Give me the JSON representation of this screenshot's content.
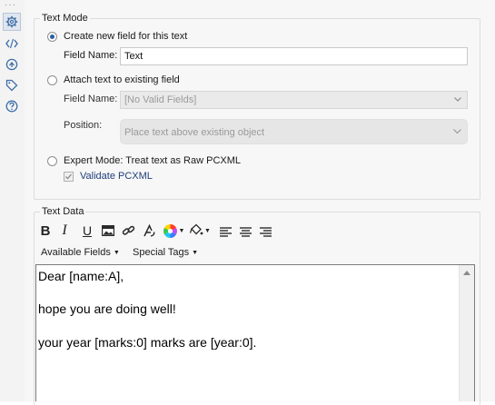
{
  "text_mode": {
    "title": "Text Mode",
    "create_new": {
      "label": "Create new field for this text",
      "selected": true
    },
    "field_name_label": "Field Name:",
    "field_name_value": "Text",
    "attach_existing": {
      "label": "Attach text to existing field",
      "selected": false
    },
    "attach_field_name_label": "Field Name:",
    "attach_field_value": "[No Valid Fields]",
    "position_label": "Position:",
    "position_value": "Place text above existing object",
    "expert_mode": {
      "label": "Expert Mode: Treat text as Raw PCXML",
      "selected": false
    },
    "validate_pcxml": {
      "label": "Validate PCXML",
      "checked": true
    }
  },
  "text_data": {
    "title": "Text Data",
    "toolbar": {
      "bold": "B",
      "italic": "I",
      "underline": "U"
    },
    "available_fields_label": "Available Fields",
    "special_tags_label": "Special Tags",
    "editor_lines": [
      "Dear [name:A],",
      "hope you are doing well!",
      "your year [marks:0] marks are [year:0]."
    ]
  },
  "colors": {
    "accent": "#2b5fa3",
    "link_text": "#1f3f7a"
  }
}
